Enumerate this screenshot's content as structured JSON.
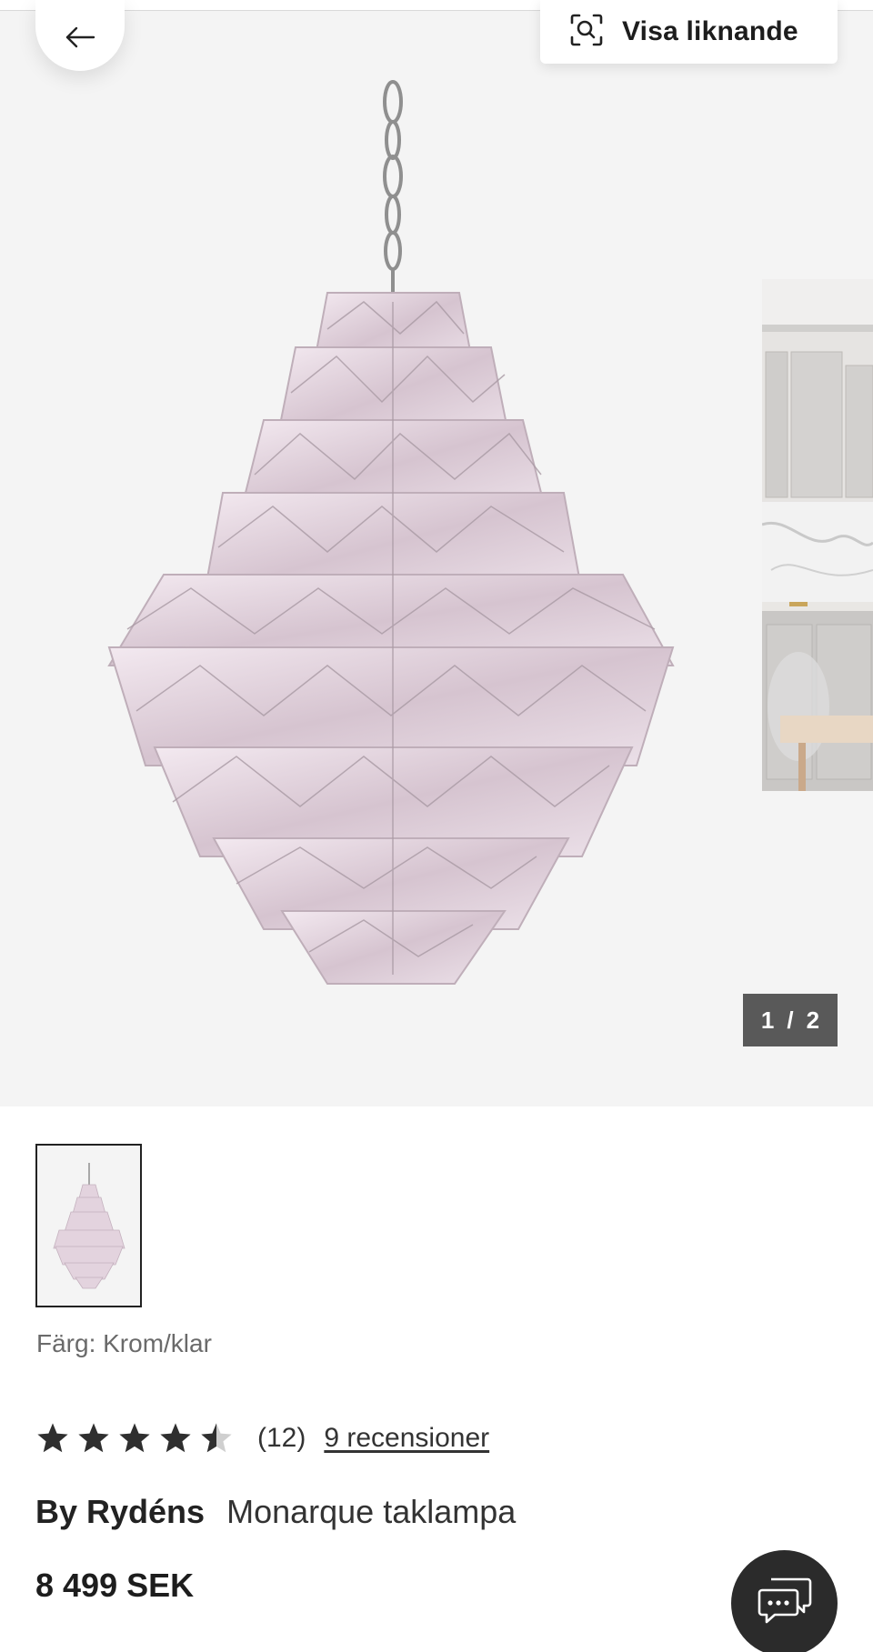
{
  "header": {
    "back_icon": "arrow-left-icon",
    "visa_liknande": {
      "icon": "visual-search-icon",
      "label": "Visa liknande"
    }
  },
  "gallery": {
    "counter": {
      "current": "1",
      "separator": "/",
      "total": "2"
    }
  },
  "product": {
    "color_label": "Färg: Krom/klar",
    "rating": {
      "value": 4.5,
      "max": 5,
      "count": "(12)",
      "reviews_link": "9 recensioner"
    },
    "brand": "By Rydéns",
    "name": "Monarque taklampa",
    "price": "8 499 SEK"
  },
  "chat": {
    "icon": "chat-bubbles-icon"
  },
  "colors": {
    "gallery_bg": "#f4f4f4",
    "star": "#2f2f2f",
    "counter_bg": "#595959",
    "chat_bg": "#2b2b2b"
  }
}
